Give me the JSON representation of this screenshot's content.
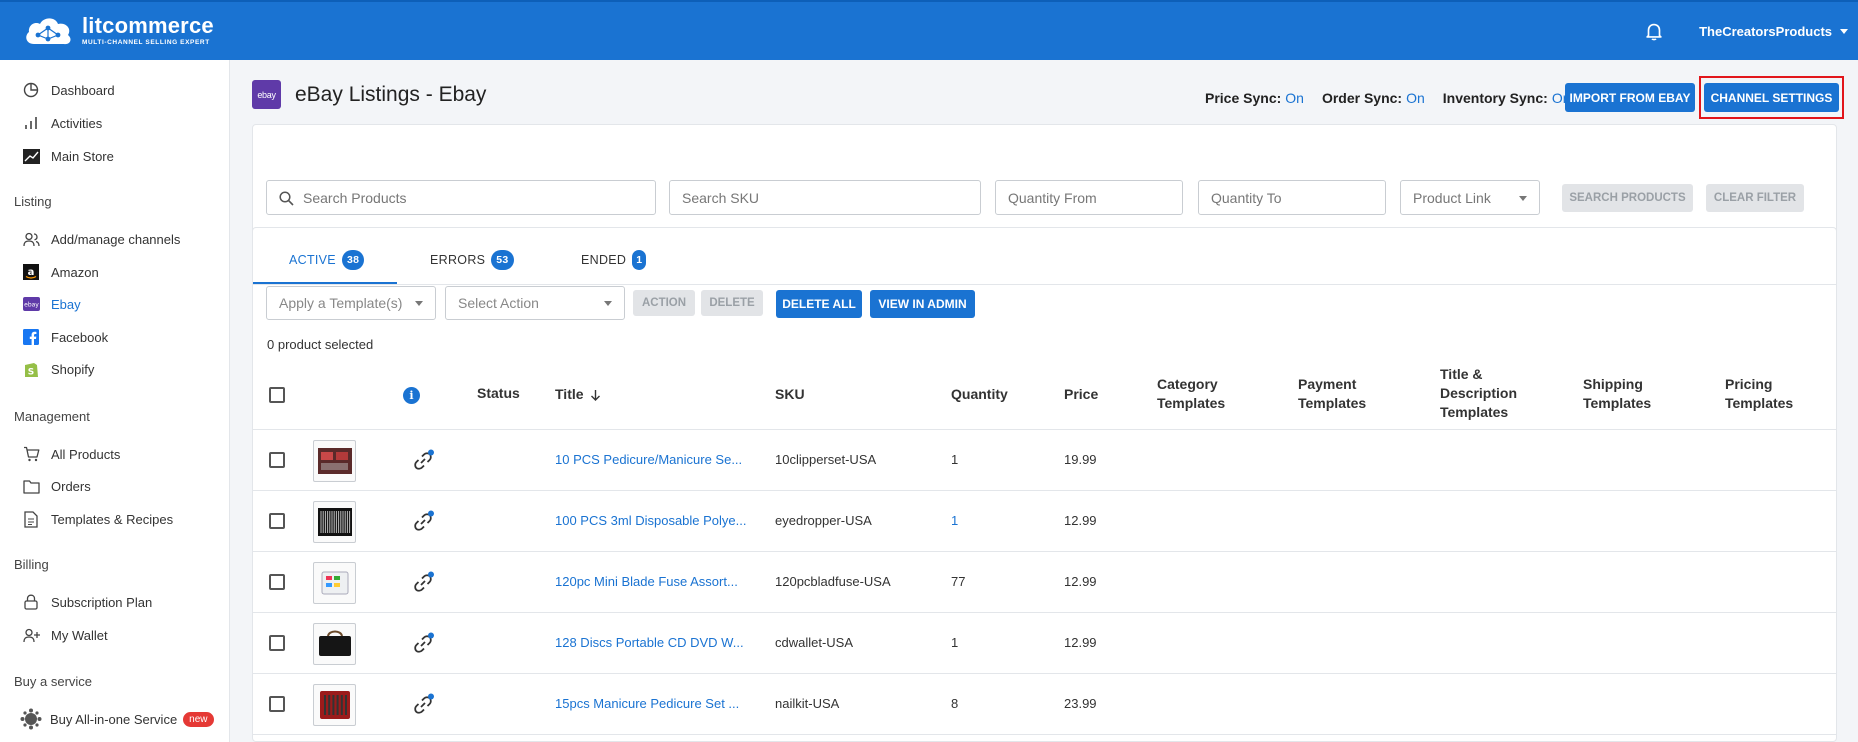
{
  "brand": {
    "name": "litcommerce",
    "tagline": "MULTI-CHANNEL SELLING EXPERT"
  },
  "header": {
    "account": "TheCreatorsProducts"
  },
  "sidebar": {
    "top": [
      {
        "label": "Dashboard",
        "icon": "pie-chart-icon"
      },
      {
        "label": "Activities",
        "icon": "bar-chart-icon"
      },
      {
        "label": "Main Store",
        "icon": "store-icon"
      }
    ],
    "listing_head": "Listing",
    "listing": [
      {
        "label": "Add/manage channels",
        "icon": "users-icon"
      },
      {
        "label": "Amazon",
        "icon": "amazon-icon"
      },
      {
        "label": "Ebay",
        "icon": "ebay-icon",
        "active": true
      },
      {
        "label": "Facebook",
        "icon": "facebook-icon"
      },
      {
        "label": "Shopify",
        "icon": "shopify-icon"
      }
    ],
    "management_head": "Management",
    "management": [
      {
        "label": "All Products",
        "icon": "cart-icon"
      },
      {
        "label": "Orders",
        "icon": "folder-icon"
      },
      {
        "label": "Templates & Recipes",
        "icon": "document-icon"
      }
    ],
    "billing_head": "Billing",
    "billing": [
      {
        "label": "Subscription Plan",
        "icon": "lock-icon"
      },
      {
        "label": "My Wallet",
        "icon": "add-user-icon"
      }
    ],
    "service_head": "Buy a service",
    "service": {
      "label": "Buy All-in-one Service",
      "badge": "new"
    }
  },
  "page": {
    "channel_tile": "ebay",
    "title": "eBay Listings - Ebay",
    "syncs": [
      {
        "label": "Price Sync:",
        "value": "On"
      },
      {
        "label": "Order Sync:",
        "value": "On"
      },
      {
        "label": "Inventory Sync:",
        "value": "On"
      }
    ],
    "import_button": "IMPORT FROM EBAY",
    "settings_button": "CHANNEL SETTINGS"
  },
  "filters": {
    "search_products": "Search Products",
    "search_sku": "Search SKU",
    "quantity_from": "Quantity From",
    "quantity_to": "Quantity To",
    "product_link": "Product Link",
    "search_button": "SEARCH PRODUCTS",
    "clear_button": "CLEAR FILTER"
  },
  "tabs": [
    {
      "label": "ACTIVE",
      "count": "38"
    },
    {
      "label": "ERRORS",
      "count": "53"
    },
    {
      "label": "ENDED",
      "count": "1"
    }
  ],
  "actions": {
    "apply_template": "Apply a Template(s)",
    "select_action": "Select Action",
    "action_button": "ACTION",
    "delete_button": "DELETE",
    "delete_all_button": "DELETE ALL",
    "view_admin_button": "VIEW IN ADMIN",
    "selected_text": "0 product selected"
  },
  "table": {
    "headers": {
      "status": "Status",
      "title": "Title",
      "sku": "SKU",
      "quantity": "Quantity",
      "price": "Price",
      "category": [
        "Category",
        "Templates"
      ],
      "payment": [
        "Payment",
        "Templates"
      ],
      "title_desc": [
        "Title &",
        "Description",
        "Templates"
      ],
      "shipping": [
        "Shipping",
        "Templates"
      ],
      "pricing": [
        "Pricing",
        "Templates"
      ]
    },
    "rows": [
      {
        "title": "10 PCS Pedicure/Manicure Se...",
        "sku": "10clipperset-USA",
        "quantity": "1",
        "price": "19.99",
        "qty_link": false
      },
      {
        "title": "100 PCS 3ml Disposable Polye...",
        "sku": "eyedropper-USA",
        "quantity": "1",
        "price": "12.99",
        "qty_link": true
      },
      {
        "title": "120pc Mini Blade Fuse Assort...",
        "sku": "120pcbladfuse-USA",
        "quantity": "77",
        "price": "12.99",
        "qty_link": false
      },
      {
        "title": "128 Discs Portable CD DVD W...",
        "sku": "cdwallet-USA",
        "quantity": "1",
        "price": "12.99",
        "qty_link": false
      },
      {
        "title": "15pcs Manicure Pedicure Set ...",
        "sku": "nailkit-USA",
        "quantity": "8",
        "price": "23.99",
        "qty_link": false
      }
    ]
  }
}
